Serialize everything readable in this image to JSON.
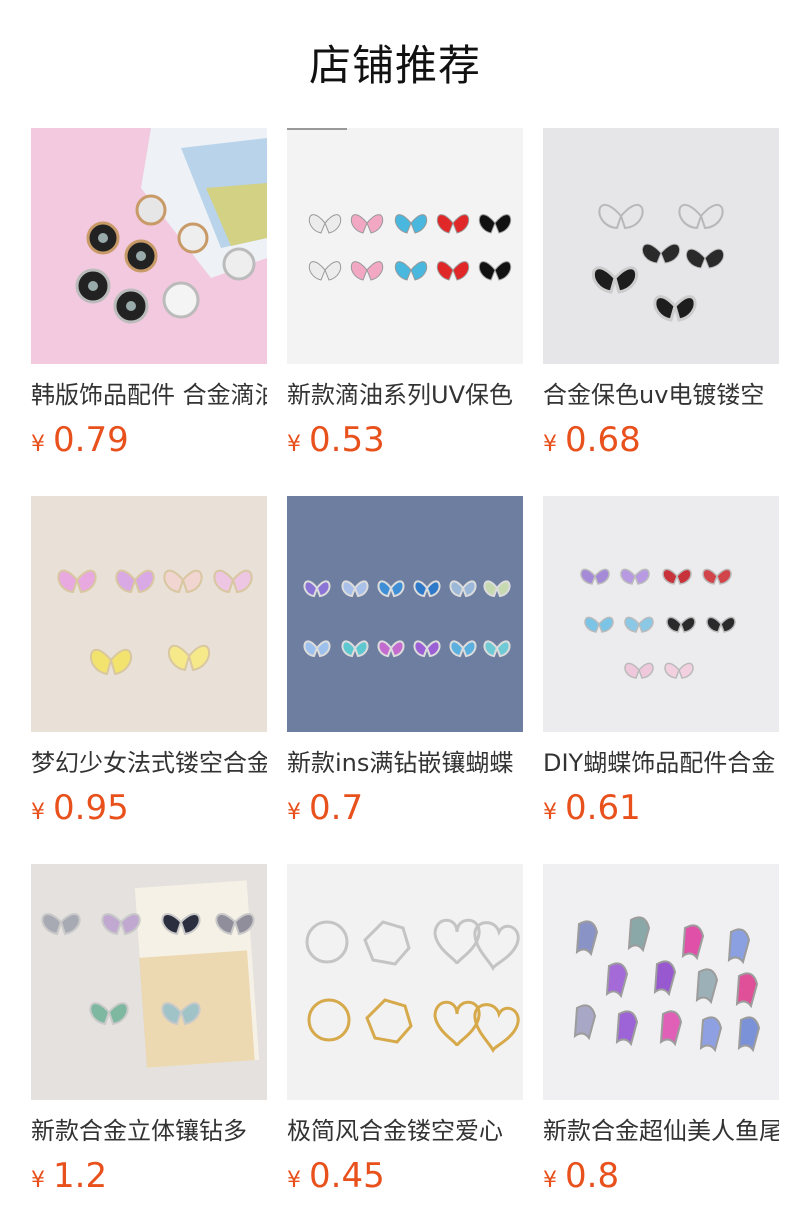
{
  "page": {
    "title": "店铺推荐"
  },
  "products": [
    {
      "name": "韩版饰品配件 合金滴油",
      "currency": "¥",
      "price": "0.79",
      "image": "round-butterfly-pendants-photo"
    },
    {
      "name": "新款滴油系列UV保色",
      "currency": "¥",
      "price": "0.53",
      "image": "enamel-butterfly-pendants-photo"
    },
    {
      "name": "合金保色uv电镀镂空",
      "currency": "¥",
      "price": "0.68",
      "image": "hollow-butterfly-pendants-photo"
    },
    {
      "name": "梦幻少女法式镂空合金",
      "currency": "¥",
      "price": "0.95",
      "image": "gradient-butterfly-pendants-photo"
    },
    {
      "name": "新款ins满钻嵌镶蝴蝶",
      "currency": "¥",
      "price": "0.7",
      "image": "rhinestone-butterfly-pendants-photo"
    },
    {
      "name": "DIY蝴蝶饰品配件合金",
      "currency": "¥",
      "price": "0.61",
      "image": "colorful-butterfly-pendants-photo"
    },
    {
      "name": "新款合金立体镶钻多",
      "currency": "¥",
      "price": "1.2",
      "image": "3d-butterfly-pendants-photo"
    },
    {
      "name": "极简风合金镂空爱心",
      "currency": "¥",
      "price": "0.45",
      "image": "hollow-heart-pendants-photo"
    },
    {
      "name": "新款合金超仙美人鱼尾",
      "currency": "¥",
      "price": "0.8",
      "image": "mermaid-tail-pendants-photo"
    }
  ],
  "colors": {
    "price": "#e8501c",
    "name": "#333333",
    "title": "#111111"
  }
}
